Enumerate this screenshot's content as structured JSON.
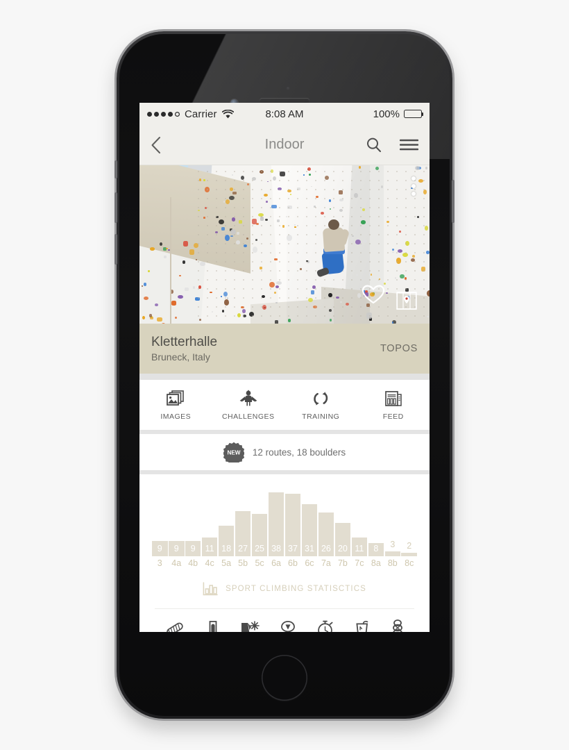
{
  "status_bar": {
    "carrier": "Carrier",
    "time": "8:08 AM",
    "battery_percent": "100%",
    "signal_bars_filled": 4,
    "signal_bars_total": 5,
    "wifi_icon": "wifi-icon",
    "battery_icon": "battery-full-icon"
  },
  "nav_bar": {
    "back_icon": "chevron-left-icon",
    "title": "Indoor",
    "search_icon": "search-icon",
    "menu_icon": "hamburger-menu-icon"
  },
  "hero": {
    "overflow_icon": "more-vertical-icon",
    "favorite_icon": "heart-outline-icon",
    "map_icon": "map-pin-icon",
    "alt": "Indoor climbing gym wall with climber"
  },
  "venue": {
    "name": "Kletterhalle",
    "location": "Bruneck, Italy",
    "topos_label": "TOPOS"
  },
  "tabs": [
    {
      "label": "IMAGES",
      "icon": "photos-stack-icon"
    },
    {
      "label": "CHALLENGES",
      "icon": "superhero-icon"
    },
    {
      "label": "TRAINING",
      "icon": "circular-arrows-icon"
    },
    {
      "label": "FEED",
      "icon": "newspaper-icon"
    }
  ],
  "routes_row": {
    "badge_label": "NEW",
    "badge_icon": "starburst-badge-icon",
    "text": "12 routes, 18 boulders"
  },
  "chart_caption": {
    "icon": "bar-chart-icon",
    "text": "SPORT CLIMBING STATISCTICS"
  },
  "bottom_icons": [
    {
      "name": "rope-icon"
    },
    {
      "name": "belay-device-icon"
    },
    {
      "name": "wall-sun-icon"
    },
    {
      "name": "climbing-hold-icon"
    },
    {
      "name": "stopwatch-icon"
    },
    {
      "name": "drink-cup-icon"
    },
    {
      "name": "knot-icon"
    }
  ],
  "colors": {
    "beige_bar": "#d8d3be",
    "chart_bar": "#e2ddd0",
    "chart_label": "#cfc7ae",
    "status_bg": "#f0efeb",
    "nav_title": "#8b8b89",
    "separator": "#e2e2e2"
  },
  "chart_data": {
    "type": "bar",
    "title": "SPORT CLIMBING STATISCTICS",
    "xlabel": "",
    "ylabel": "",
    "ylim": [
      0,
      38
    ],
    "grid": false,
    "legend": null,
    "categories": [
      "3",
      "4a",
      "4b",
      "4c",
      "5a",
      "5b",
      "5c",
      "6a",
      "6b",
      "6c",
      "7a",
      "7b",
      "7c",
      "8a",
      "8b",
      "8c"
    ],
    "values": [
      9,
      9,
      9,
      11,
      18,
      27,
      25,
      38,
      37,
      31,
      26,
      20,
      11,
      8,
      3,
      2
    ],
    "value_label_position": [
      "inside",
      "inside",
      "inside",
      "inside",
      "inside",
      "inside",
      "inside",
      "inside",
      "inside",
      "inside",
      "inside",
      "inside",
      "inside",
      "inside",
      "outside",
      "outside"
    ]
  }
}
